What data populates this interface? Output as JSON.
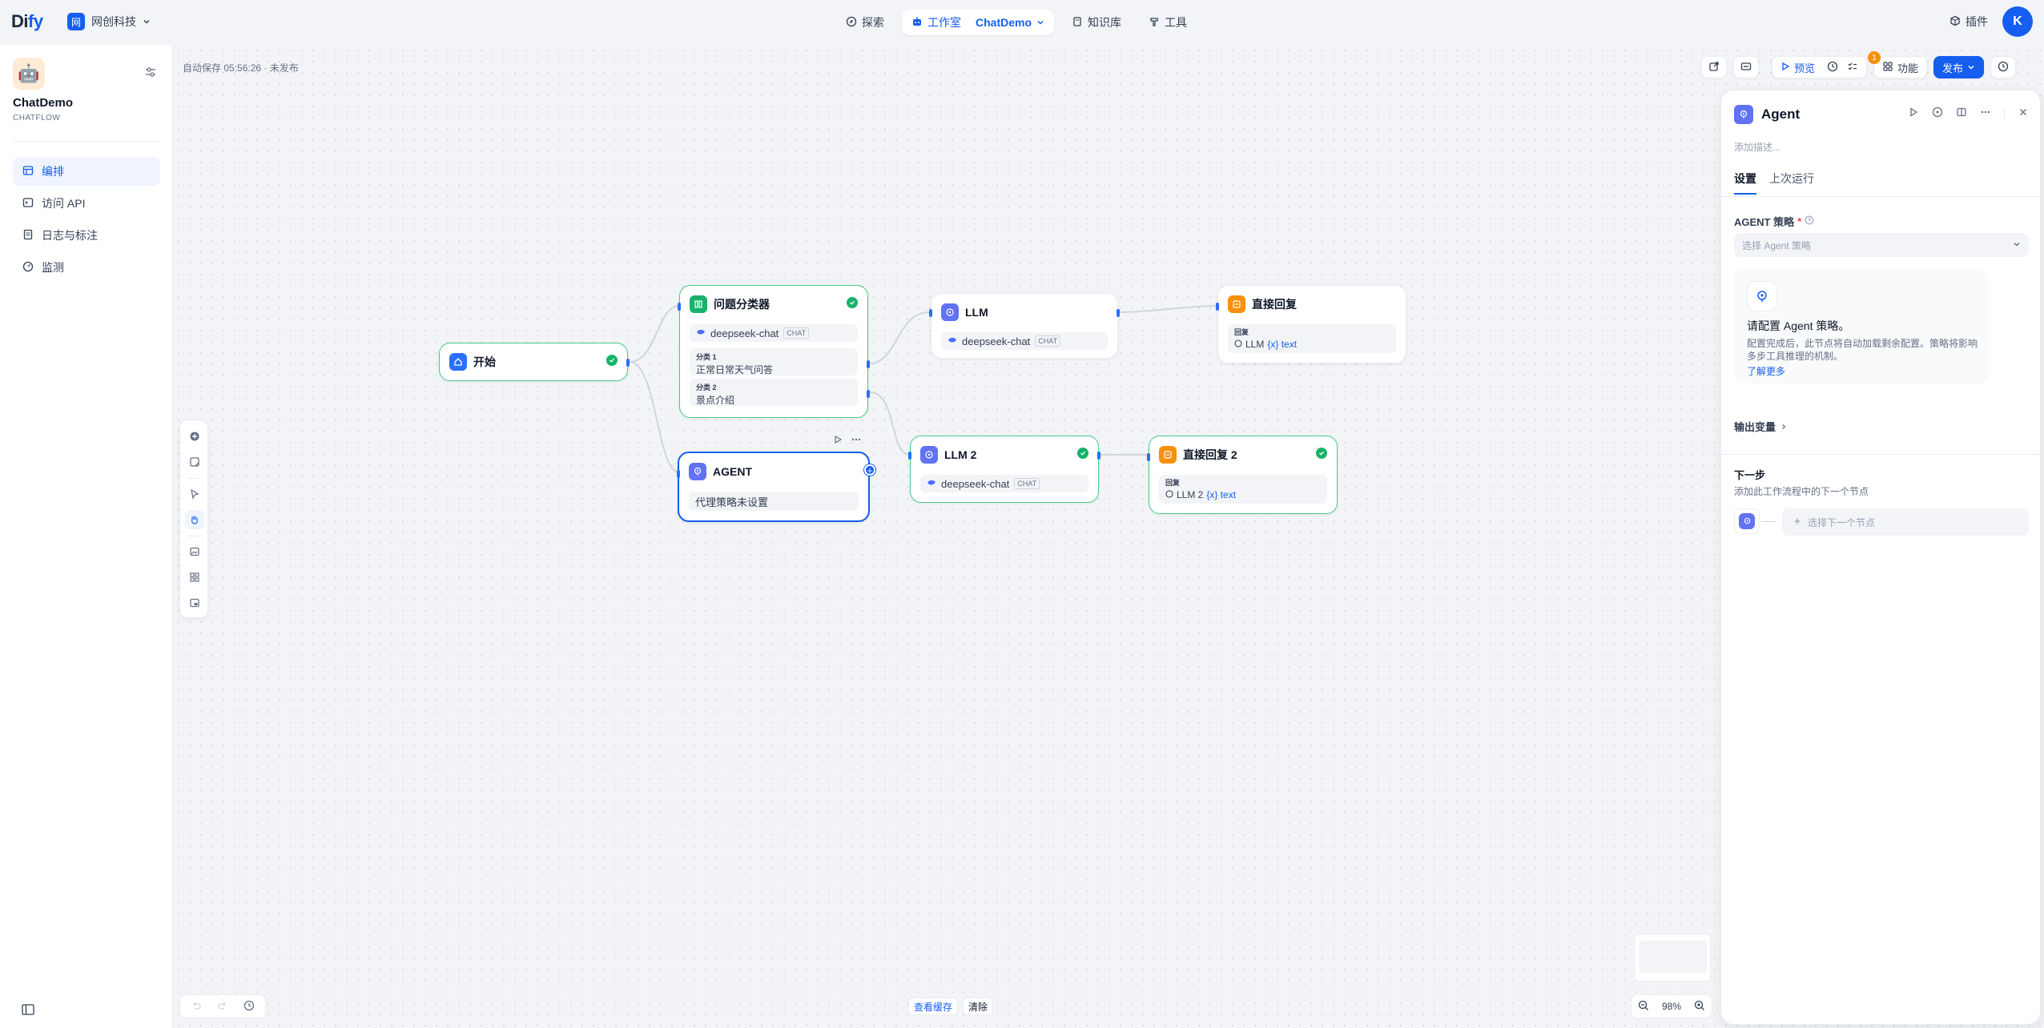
{
  "topnav": {
    "logo_main": "Di",
    "logo_accent": "fy",
    "workspace_initial": "网",
    "workspace_name": "网创科技",
    "nav": [
      {
        "label": "探索"
      },
      {
        "label": "工作室",
        "app": "ChatDemo"
      },
      {
        "label": "知识库"
      },
      {
        "label": "工具"
      }
    ],
    "plugin_label": "插件",
    "avatar_initial": "K"
  },
  "sidebar": {
    "app_name": "ChatDemo",
    "app_mode": "CHATFLOW",
    "items": [
      {
        "label": "编排"
      },
      {
        "label": "访问 API"
      },
      {
        "label": "日志与标注"
      },
      {
        "label": "监测"
      }
    ]
  },
  "canvas": {
    "autosave": "自动保存 05:56:26 · 未发布",
    "actions": {
      "preview": "预览",
      "features": "功能",
      "publish": "发布",
      "checklist_count": "1"
    },
    "bottom": {
      "view_cache": "查看缓存",
      "clear": "清除",
      "zoom": "98%"
    }
  },
  "nodes": {
    "start": {
      "title": "开始"
    },
    "classifier": {
      "title": "问题分类器",
      "model": "deepseek-chat",
      "tag": "CHAT",
      "classes": [
        {
          "key": "分类 1",
          "value": "正常日常天气问答"
        },
        {
          "key": "分类 2",
          "value": "景点介绍"
        }
      ]
    },
    "llm": {
      "title": "LLM",
      "model": "deepseek-chat",
      "tag": "CHAT"
    },
    "reply": {
      "title": "直接回复",
      "label": "回复",
      "src": "LLM",
      "var": "{x} text"
    },
    "agent": {
      "title": "AGENT",
      "body": "代理策略未设置"
    },
    "llm2": {
      "title": "LLM 2",
      "model": "deepseek-chat",
      "tag": "CHAT"
    },
    "reply2": {
      "title": "直接回复 2",
      "label": "回复",
      "src": "LLM 2",
      "var": "{x} text"
    }
  },
  "panel": {
    "title": "Agent",
    "desc_placeholder": "添加描述...",
    "tabs": [
      {
        "label": "设置"
      },
      {
        "label": "上次运行"
      }
    ],
    "strategy_label": "AGENT 策略",
    "strategy_placeholder": "选择 Agent 策略",
    "card_title": "请配置 Agent 策略。",
    "card_text": "配置完成后，此节点将自动加载剩余配置。策略将影响多步工具推理的机制。",
    "card_link": "了解更多",
    "output_label": "输出变量",
    "next_label": "下一步",
    "next_sub": "添加此工作流程中的下一个节点",
    "next_placeholder": "选择下一个节点"
  },
  "colors": {
    "primary": "#155eef",
    "success": "#17b26a",
    "warning": "#f79009",
    "agent": "#6172f3"
  }
}
